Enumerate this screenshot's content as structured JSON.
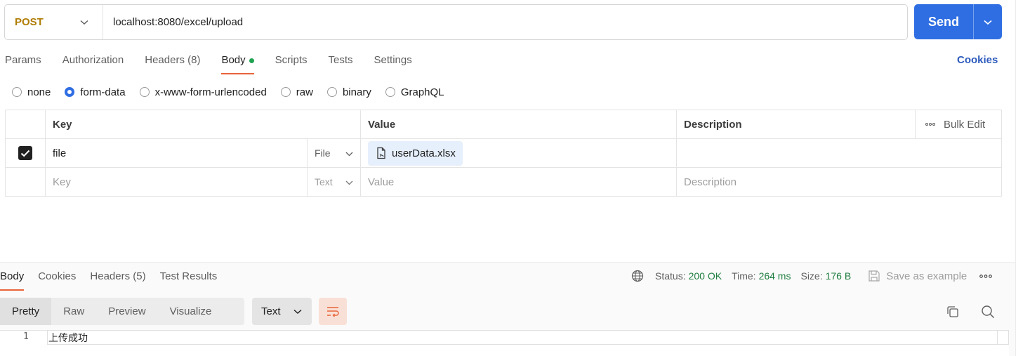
{
  "request": {
    "method": "POST",
    "url": "localhost:8080/excel/upload",
    "send_label": "Send"
  },
  "request_tabs": [
    {
      "label": "Params"
    },
    {
      "label": "Authorization"
    },
    {
      "label": "Headers (8)"
    },
    {
      "label": "Body",
      "active": true,
      "has_dot": true
    },
    {
      "label": "Scripts"
    },
    {
      "label": "Tests"
    },
    {
      "label": "Settings"
    }
  ],
  "cookies_label": "Cookies",
  "body_types": {
    "none": "none",
    "form_data": "form-data",
    "urlencoded": "x-www-form-urlencoded",
    "raw": "raw",
    "binary": "binary",
    "graphql": "GraphQL",
    "selected": "form-data"
  },
  "params_table": {
    "headers": {
      "key": "Key",
      "value": "Value",
      "description": "Description",
      "bulk_edit": "Bulk Edit"
    },
    "rows": [
      {
        "checked": true,
        "key": "file",
        "type": "File",
        "value": "userData.xlsx",
        "description": ""
      }
    ],
    "empty_row": {
      "key_placeholder": "Key",
      "type": "Text",
      "value_placeholder": "Value",
      "description_placeholder": "Description"
    }
  },
  "response": {
    "tabs": [
      {
        "label": "Body",
        "active": true
      },
      {
        "label": "Cookies"
      },
      {
        "label": "Headers (5)"
      },
      {
        "label": "Test Results"
      }
    ],
    "status_label": "Status:",
    "status_value": "200 OK",
    "time_label": "Time:",
    "time_value": "264 ms",
    "size_label": "Size:",
    "size_value": "176 B",
    "save_example_label": "Save as example",
    "view_tabs": [
      "Pretty",
      "Raw",
      "Preview",
      "Visualize"
    ],
    "format": "Text",
    "lines": [
      {
        "number": "1",
        "text": "上传成功"
      }
    ]
  },
  "colors": {
    "method": "#b07c05",
    "send": "#2f6ee2",
    "active_tab_underline": "#e8643a",
    "status_ok": "#1e7d3f",
    "link": "#2d5bbd"
  }
}
